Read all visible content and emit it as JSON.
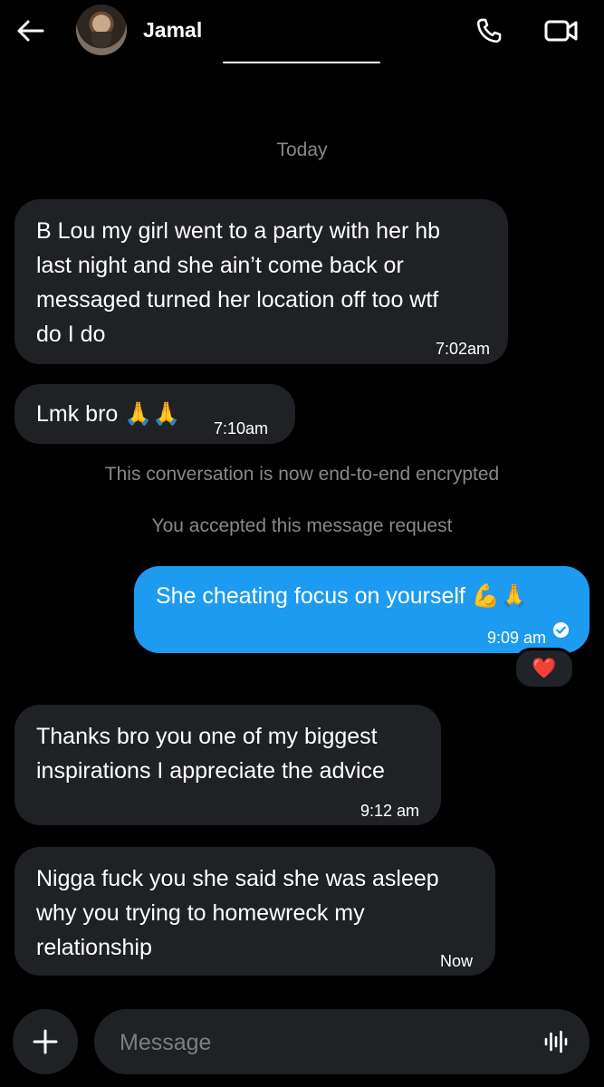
{
  "header": {
    "contact_name": "Jamal",
    "icons": [
      "back-arrow-icon",
      "avatar",
      "phone-icon",
      "video-camera-icon"
    ]
  },
  "conversation": {
    "date_label": "Today",
    "messages": [
      {
        "direction": "incoming",
        "lines": [
          "B Lou my girl went to a party with her hb",
          "last night and she ain’t come back or",
          "messaged turned her location off too wtf",
          "do I do"
        ],
        "time": "7:02am"
      },
      {
        "direction": "incoming",
        "lines": [
          "Lmk bro 🙏🙏"
        ],
        "time": "7:10am"
      },
      {
        "direction": "outgoing",
        "lines": [
          "She cheating focus on yourself 💪🙏"
        ],
        "time": "9:09 am",
        "read_icon": "check-circle-icon",
        "reaction": "❤️"
      },
      {
        "direction": "incoming",
        "lines": [
          "Thanks bro you one of my biggest",
          "inspirations I appreciate the advice"
        ],
        "time": "9:12 am"
      },
      {
        "direction": "incoming",
        "lines": [
          "Nigga fuck you she said she was asleep",
          "why you trying to homewreck my",
          "relationship"
        ],
        "time": "Now"
      }
    ],
    "system_notes": [
      "This conversation is now end-to-end encrypted",
      "You accepted this message request"
    ]
  },
  "composer": {
    "placeholder": "Message",
    "icons": [
      "plus-icon",
      "voice-wave-icon"
    ]
  },
  "colors": {
    "background": "#000000",
    "incoming_bubble": "#1f2124",
    "outgoing_bubble": "#1d9bf0",
    "system_text": "#85888c"
  }
}
